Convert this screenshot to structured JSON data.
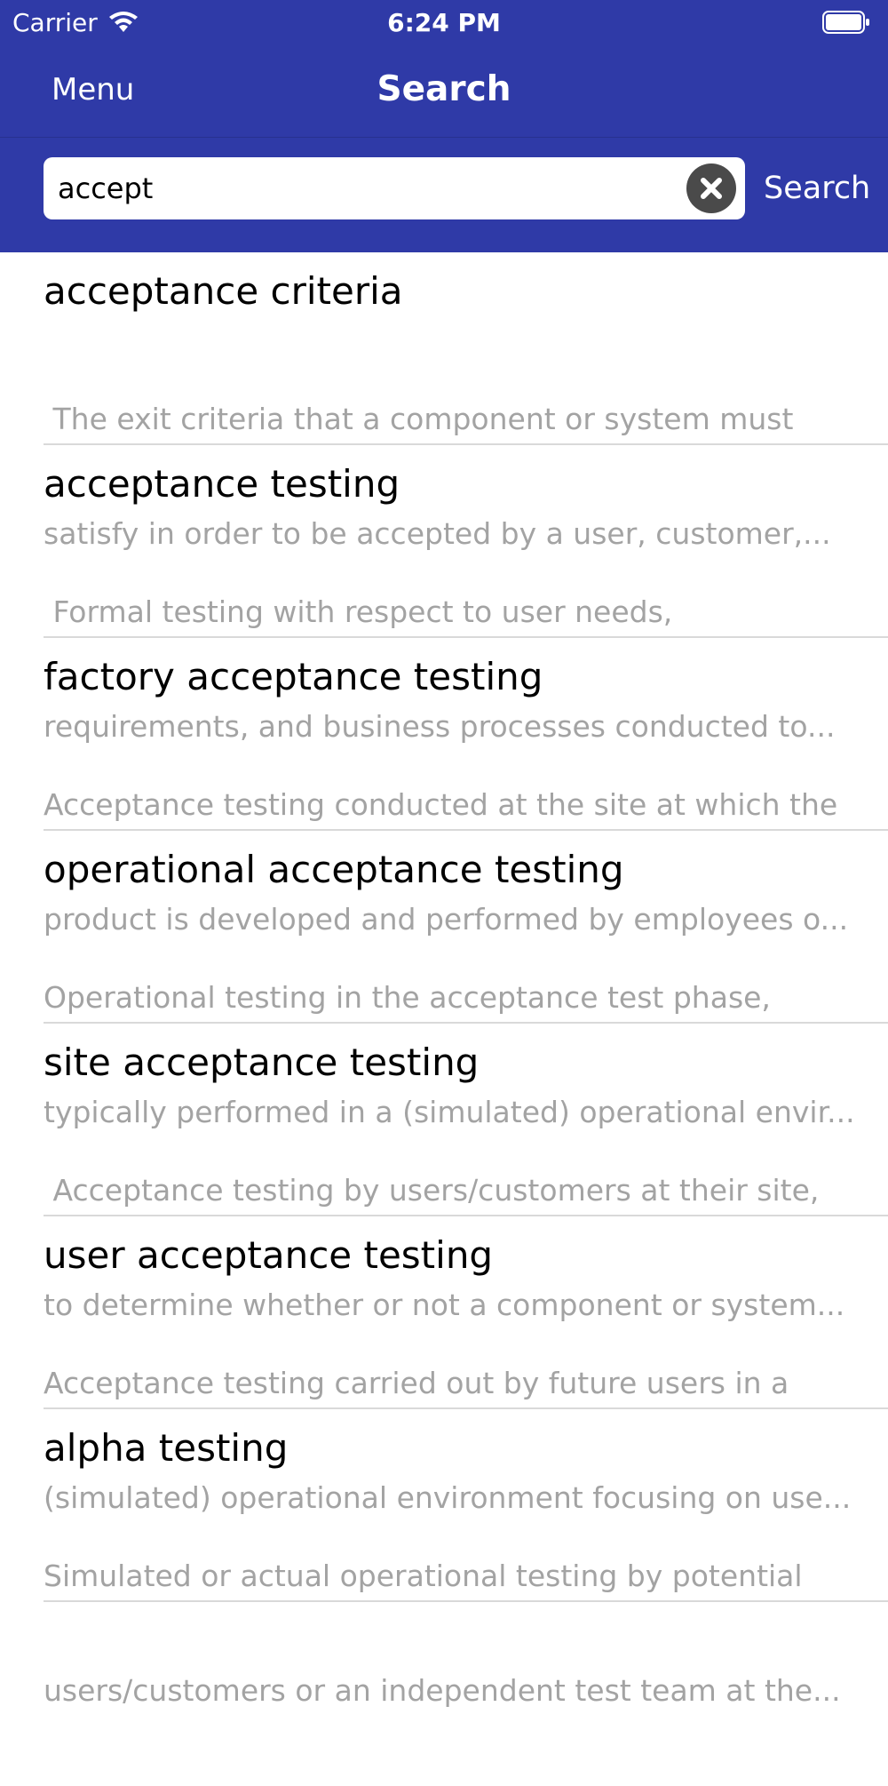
{
  "status_bar": {
    "carrier": "Carrier",
    "time": "6:24 PM",
    "wifi_icon": "wifi-icon",
    "battery_icon": "battery-full-icon"
  },
  "nav": {
    "menu_label": "Menu",
    "title": "Search"
  },
  "search": {
    "value": "accept",
    "clear_icon": "clear-circle-icon",
    "button_label": "Search"
  },
  "colors": {
    "bar_background": "#2f3aa7",
    "description_text": "#a3a3a3",
    "separator": "#d9d9d9"
  },
  "results": [
    {
      "title": "acceptance criteria",
      "desc_line1": " The exit criteria that a component or system must",
      "desc_line2": "satisfy in order to be accepted by a user, customer,..."
    },
    {
      "title": "acceptance testing",
      "desc_line1": " Formal testing with respect to user needs,",
      "desc_line2": "requirements, and business processes conducted to..."
    },
    {
      "title": "factory acceptance testing",
      "desc_line1": "Acceptance testing conducted at the site at which the",
      "desc_line2": "product is developed and performed by employees o..."
    },
    {
      "title": "operational acceptance testing",
      "desc_line1": "Operational testing in the acceptance test phase,",
      "desc_line2": "typically performed in a (simulated) operational envir..."
    },
    {
      "title": "site acceptance testing",
      "desc_line1": " Acceptance testing by users/customers at their site,",
      "desc_line2": "to determine whether or not a component or system..."
    },
    {
      "title": "user acceptance testing",
      "desc_line1": "Acceptance testing carried out by future users in a",
      "desc_line2": "(simulated) operational environment focusing on use..."
    },
    {
      "title": "alpha testing",
      "desc_line1": "Simulated or actual operational testing by potential",
      "desc_line2": "users/customers or an independent test team at the..."
    }
  ]
}
